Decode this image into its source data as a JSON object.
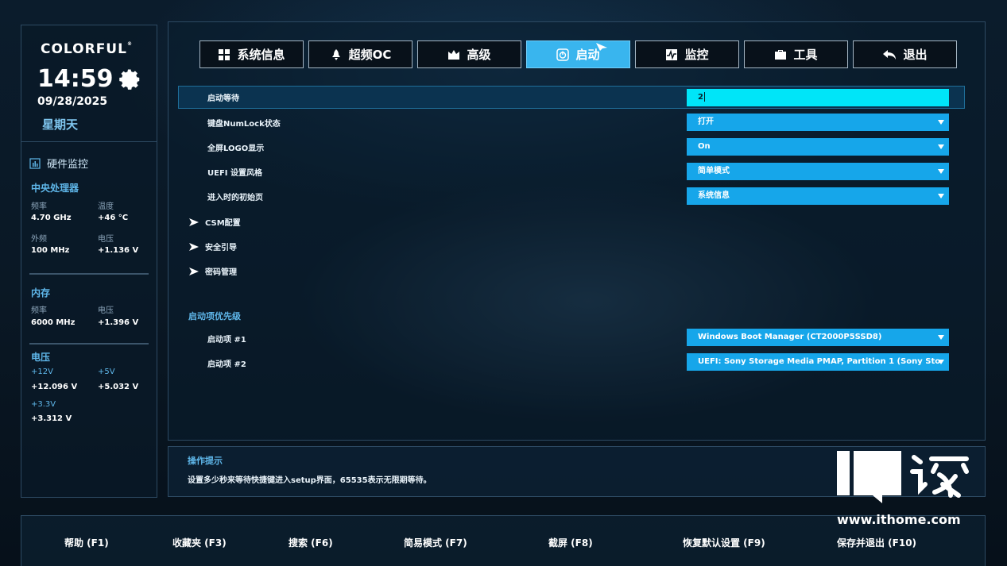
{
  "brand": {
    "name": "COLORFUL",
    "mark": "®"
  },
  "clock": {
    "time": "14:59",
    "date": "09/28/2025",
    "weekday": "星期天"
  },
  "hardware": {
    "title": "硬件监控",
    "cpu": {
      "title": "中央处理器",
      "freq_label": "频率",
      "freq_value": "4.70 GHz",
      "temp_label": "温度",
      "temp_value": "+46 °C",
      "bclk_label": "外频",
      "bclk_value": "100 MHz",
      "volt_label": "电压",
      "volt_value": "+1.136 V"
    },
    "memory": {
      "title": "内存",
      "freq_label": "频率",
      "freq_value": "6000 MHz",
      "volt_label": "电压",
      "volt_value": "+1.396 V"
    },
    "voltage": {
      "title": "电压",
      "v12_label": "+12V",
      "v12_value": "+12.096 V",
      "v5_label": "+5V",
      "v5_value": "+5.032 V",
      "v33_label": "+3.3V",
      "v33_value": "+3.312 V"
    }
  },
  "tabs": [
    {
      "label": "系统信息",
      "icon": "grid-icon"
    },
    {
      "label": "超频OC",
      "icon": "rocket-icon"
    },
    {
      "label": "高级",
      "icon": "crown-icon"
    },
    {
      "label": "启动",
      "icon": "power-icon",
      "active": true
    },
    {
      "label": "监控",
      "icon": "monitor-icon"
    },
    {
      "label": "工具",
      "icon": "toolbox-icon"
    },
    {
      "label": "退出",
      "icon": "back-arrow-icon"
    }
  ],
  "settings": {
    "boot_wait": {
      "label": "启动等待",
      "value": "2"
    },
    "numlock": {
      "label": "键盘NumLock状态",
      "value": "打开"
    },
    "logo": {
      "label": "全屏LOGO显示",
      "value": "On"
    },
    "uefi_style": {
      "label": "UEFI 设置风格",
      "value": "简单模式"
    },
    "init_page": {
      "label": "进入时的初始页",
      "value": "系统信息"
    },
    "csm": {
      "label": "CSM配置"
    },
    "secure_boot": {
      "label": "安全引导"
    },
    "password": {
      "label": "密码管理"
    },
    "boot_priority": {
      "title": "启动项优先级",
      "item1_label": "启动项 #1",
      "item1_value": "Windows Boot Manager (CT2000P5SSD8)",
      "item2_label": "启动项 #2",
      "item2_value": "UEFI: Sony Storage Media PMAP, Partition 1 (Sony Sto"
    }
  },
  "hint": {
    "title": "操作提示",
    "text": "设置多少秒来等待快捷键进入setup界面，65535表示无限期等待。"
  },
  "watermark": {
    "text": "www.ithome.com"
  },
  "footer": {
    "help": "帮助 (F1)",
    "favorites": "收藏夹 (F3)",
    "search": "搜索 (F6)",
    "easy_mode": "简易模式 (F7)",
    "screenshot": "截屏 (F8)",
    "restore": "恢复默认设置 (F9)",
    "save_exit": "保存并退出 (F10)"
  },
  "colors": {
    "accent": "#16a6ea",
    "active_input": "#00e5f8",
    "label_blue": "#5fb7ea"
  }
}
